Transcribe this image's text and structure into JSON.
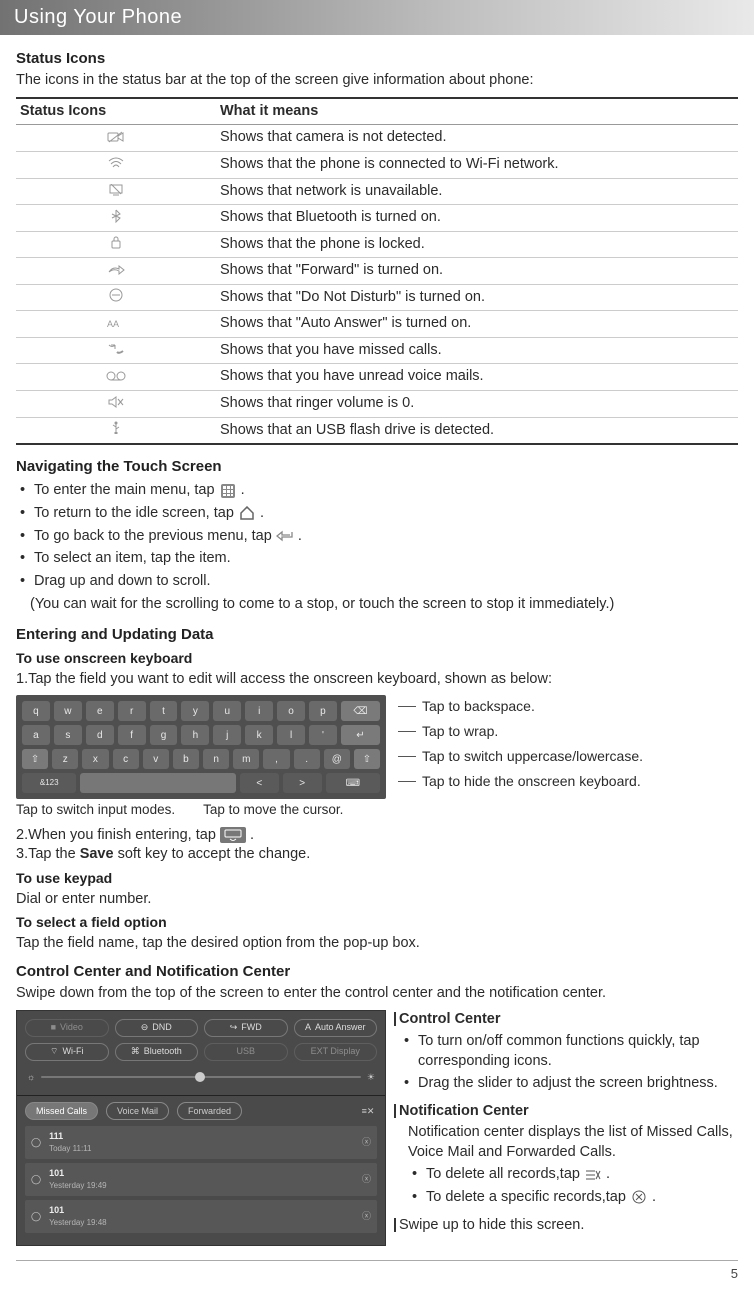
{
  "title": "Using Your Phone",
  "status": {
    "heading": "Status Icons",
    "intro": "The icons in the status bar at the top of the screen give information about phone:",
    "col1": "Status Icons",
    "col2": "What it means",
    "rows": [
      "Shows that camera is not detected.",
      "Shows that the phone is connected to Wi-Fi network.",
      "Shows that network is unavailable.",
      "Shows that Bluetooth is turned on.",
      "Shows that the phone is locked.",
      "Shows that \"Forward\" is turned on.",
      "Shows that \"Do Not Disturb\" is turned on.",
      "Shows that \"Auto Answer\" is turned on.",
      "Shows that you have missed calls.",
      "Shows that you have unread voice mails.",
      "Shows that ringer volume is 0.",
      "Shows that  an USB flash drive is detected."
    ]
  },
  "nav": {
    "heading": "Navigating the Touch Screen",
    "b1a": "To enter the main menu, tap ",
    "b1b": " .",
    "b2a": "To return to the idle screen, tap",
    "b2b": " .",
    "b3a": "To go back to the previous menu, tap ",
    "b3b": " .",
    "b4": "To select an item, tap the item.",
    "b5": "Drag up and down to scroll.",
    "b5_sub": "(You can wait for the scrolling to come to a stop, or touch the screen to stop it immediately.)"
  },
  "enter": {
    "heading": "Entering and Updating Data",
    "sub1": "To use onscreen keyboard",
    "step1": "1.Tap the field you want to edit will access the onscreen keyboard, shown as below:",
    "lbl_back": "Tap to backspace.",
    "lbl_wrap": "Tap to wrap.",
    "lbl_case": "Tap to switch uppercase/lowercase.",
    "lbl_hide": "Tap to hide the onscreen keyboard.",
    "lbl_modes": "Tap to switch input modes.",
    "lbl_cursor": "Tap to move the cursor.",
    "step2a": "2.When you finish entering, tap",
    "step2b": " .",
    "step3a": "3.Tap the ",
    "step3_save": "Save",
    "step3b": " soft key to accept the change.",
    "sub2": "To use keypad",
    "sub2_body": "Dial or enter number.",
    "sub3": "To select a field option",
    "sub3_body": "Tap the field name, tap the desired option from the pop-up box."
  },
  "cc": {
    "heading": "Control Center and Notification Center",
    "intro": "Swipe down from the top of the screen to enter the control center and the notification center.",
    "label_cc": "Control Center",
    "cc_b1": "To turn on/off common functions quickly, tap corresponding icons.",
    "cc_b2": "Drag the slider to adjust the screen brightness.",
    "label_nc": "Notification Center",
    "nc_intro": "Notification center displays the list of Missed Calls, Voice Mail and Forwarded Calls.",
    "nc_b1a": "To delete all records,tap",
    "nc_b1b": " .",
    "nc_b2a": "To delete a specific records,tap ",
    "nc_b2b": " .",
    "swipe": "Swipe up to hide this screen.",
    "panel": {
      "btn_video": "Video",
      "btn_dnd": "DND",
      "btn_fwd": "FWD",
      "btn_aa": "Auto Answer",
      "btn_wifi": "Wi-Fi",
      "btn_bt": "Bluetooth",
      "btn_usb": "USB",
      "btn_ext": "EXT Display",
      "tab_missed": "Missed Calls",
      "tab_vm": "Voice Mail",
      "tab_fwd": "Forwarded",
      "r1_num": "111",
      "r1_when": "Today 11:11",
      "r2_num": "101",
      "r2_when": "Yesterday 19:49",
      "r3_num": "101",
      "r3_when": "Yesterday 19:48"
    }
  },
  "footer_page": "5"
}
